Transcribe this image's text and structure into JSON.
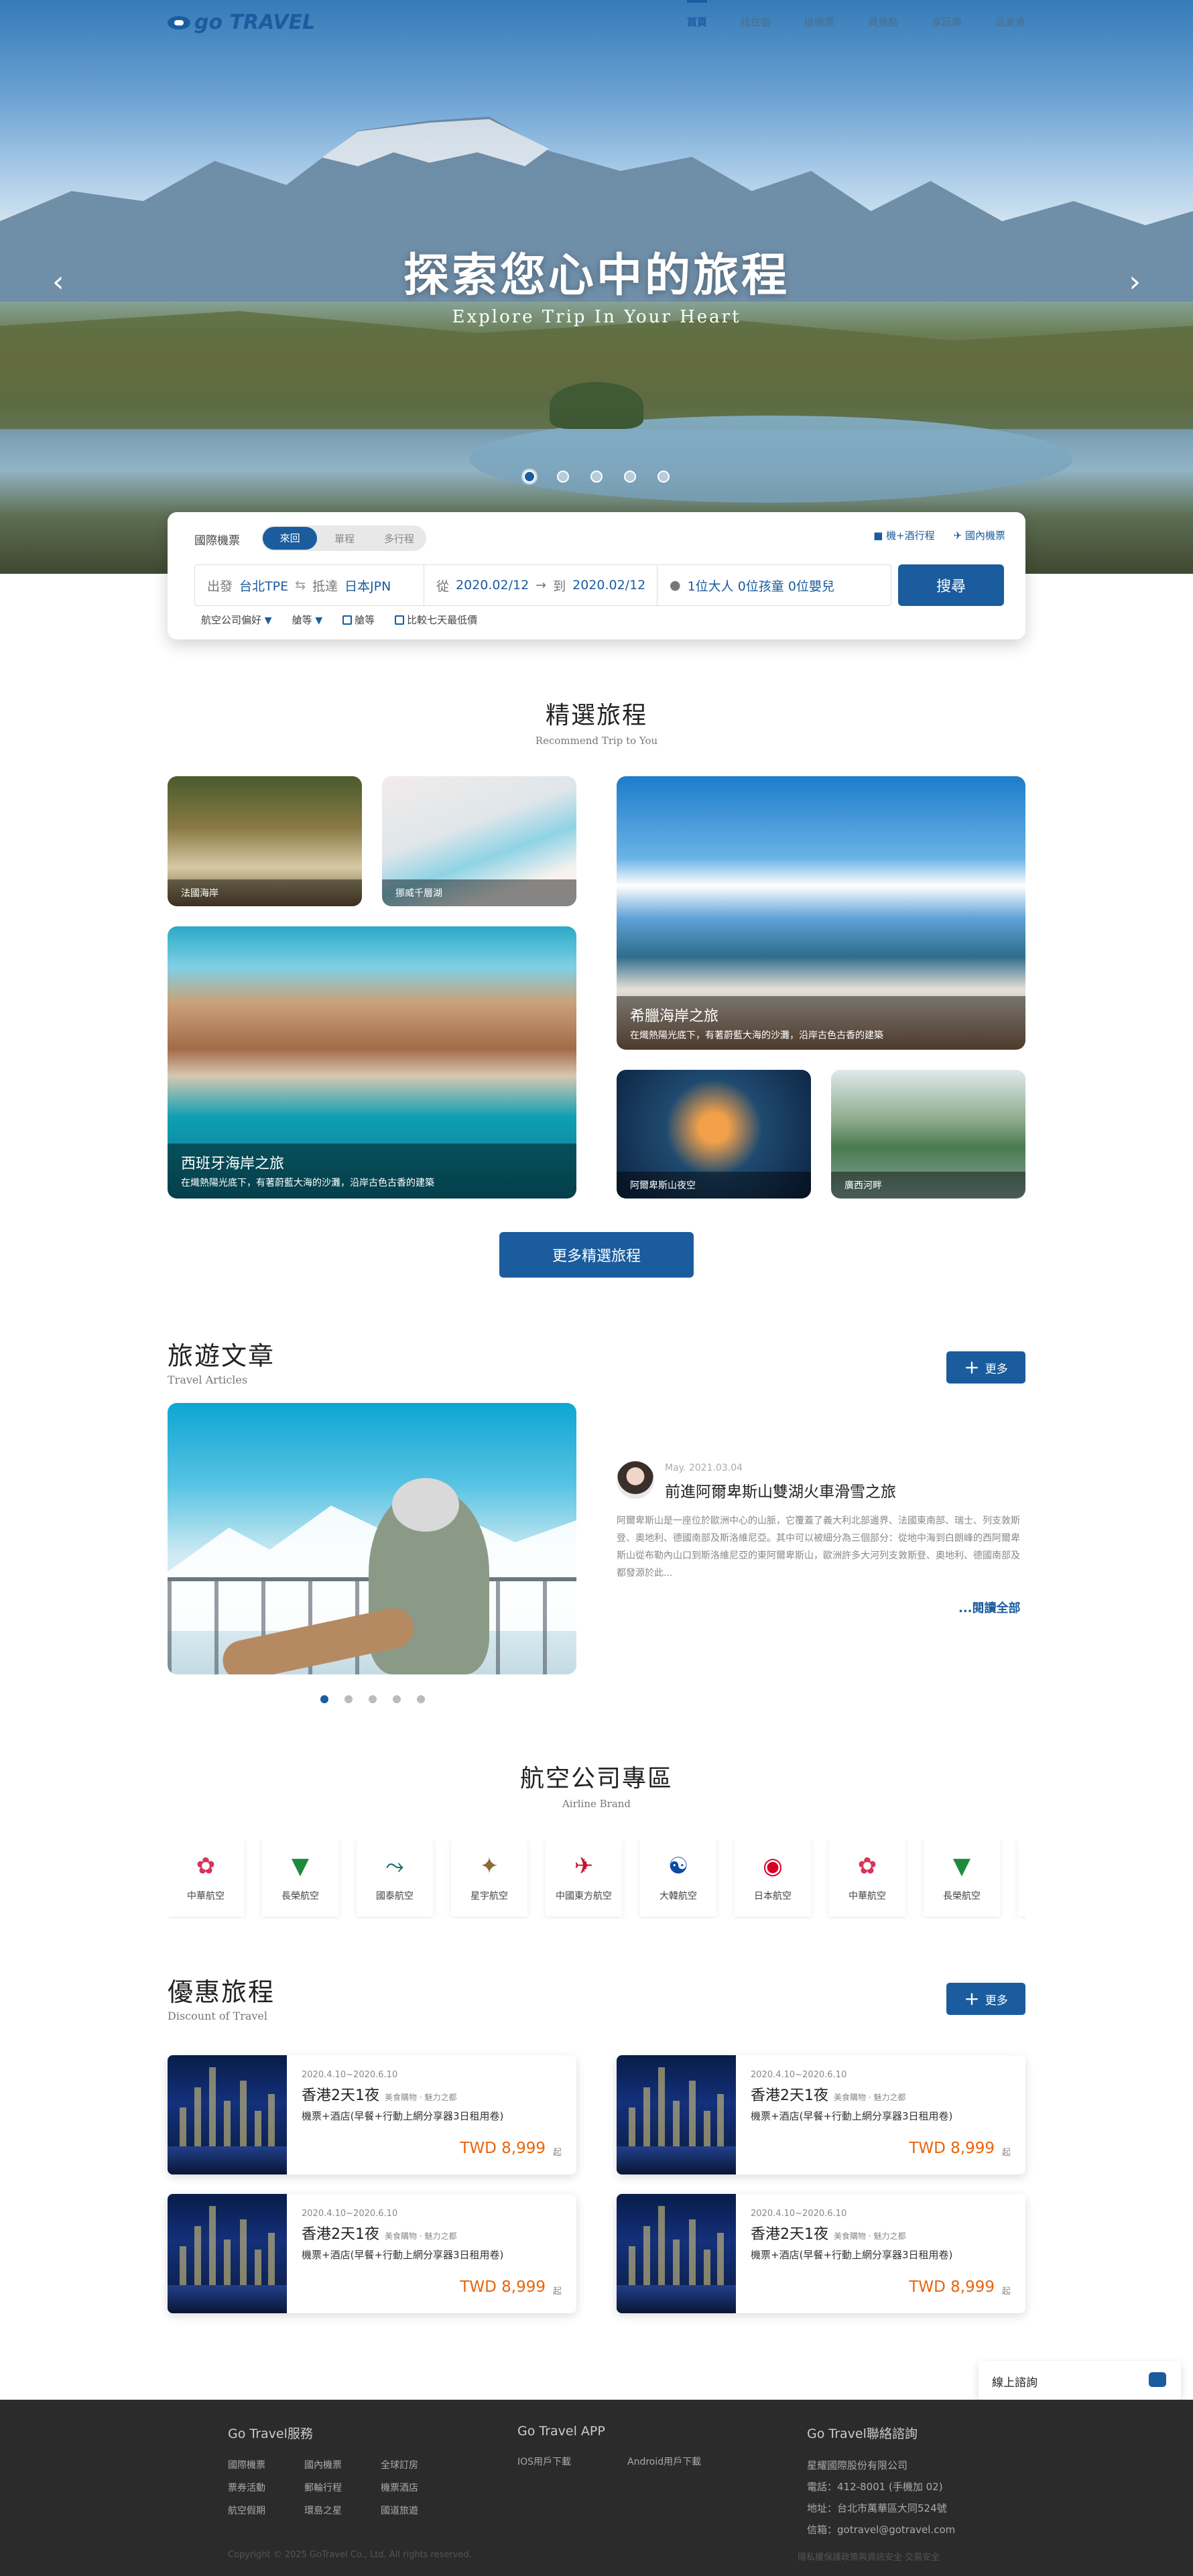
{
  "brand": {
    "logo": "go TRAVEL"
  },
  "nav": {
    "items": [
      "首頁",
      "找住宿",
      "搶機票",
      "買景點",
      "享玩樂",
      "品美食"
    ]
  },
  "hero": {
    "title": "探索您心中的旅程",
    "subtitle": "Explore Trip In Your Heart"
  },
  "search": {
    "type_label": "國際機票",
    "segments": [
      "來回",
      "單程",
      "多行程"
    ],
    "link_hotel": "機+酒行程",
    "link_domestic": "國內機票",
    "from_label": "出發",
    "from_value": "台北TPE",
    "to_label": "抵達",
    "to_value": "日本JPN",
    "date_from_label": "從",
    "date_from": "2020.02/12",
    "date_to_label": "到",
    "date_to": "2020.02/12",
    "passengers": "1位大人  0位孩童  0位嬰兒",
    "button": "搜尋",
    "opt_airline": "航空公司偏好",
    "opt_class": "艙等",
    "opt_check1": "艙等",
    "opt_check2": "比較七天最低價"
  },
  "featured": {
    "title": "精選旅程",
    "subtitle": "Recommend Trip to You",
    "cards": [
      {
        "label": "法國海岸"
      },
      {
        "label": "挪威千層湖"
      },
      {
        "title": "希臘海岸之旅",
        "desc": "在熾熱陽光底下，有著蔚藍大海的沙灘，沿岸古色古香的建築"
      },
      {
        "title": "西班牙海岸之旅",
        "desc": "在熾熱陽光底下，有著蔚藍大海的沙灘，沿岸古色古香的建築"
      },
      {
        "label": "阿爾卑斯山夜空"
      },
      {
        "label": "廣西河畔"
      }
    ],
    "more": "更多精選旅程"
  },
  "articles": {
    "title": "旅遊文章",
    "subtitle": "Travel Articles",
    "more": "更多",
    "date": "May. 2021.03.04",
    "headline": "前進阿爾卑斯山雙湖火車滑雪之旅",
    "body": "阿爾卑斯山是一座位於歐洲中心的山脈，它覆蓋了義大利北部邊界、法國東南部、瑞士、列支敦斯登、奧地利、德國南部及斯洛維尼亞。其中可以被細分為三個部分：從地中海到白朗峰的西阿爾卑斯山從布勒內山口到斯洛維尼亞的東阿爾卑斯山，歐洲許多大河列支敦斯登、奧地利、德國南部及都發源於此...",
    "read_all": "...閱讀全部"
  },
  "airlines": {
    "title": "航空公司專區",
    "subtitle": "Airline Brand",
    "items": [
      {
        "name": "中華航空",
        "icon": "plum-blossom-icon",
        "color": "#d8335a",
        "glyph": "✿"
      },
      {
        "name": "長榮航空",
        "icon": "evergreen-icon",
        "color": "#1f8a3c",
        "glyph": "▼"
      },
      {
        "name": "國泰航空",
        "icon": "cathay-wing-icon",
        "color": "#0b6b6b",
        "glyph": "⤳"
      },
      {
        "name": "星宇航空",
        "icon": "starlux-icon",
        "color": "#8c6a3a",
        "glyph": "✦"
      },
      {
        "name": "中國東方航空",
        "icon": "china-eastern-icon",
        "color": "#c8102e",
        "glyph": "✈"
      },
      {
        "name": "大韓航空",
        "icon": "taeguk-icon",
        "color": "#0a4aa0",
        "glyph": "☯"
      },
      {
        "name": "日本航空",
        "icon": "crane-icon",
        "color": "#d7002a",
        "glyph": "◉"
      },
      {
        "name": "中華航空",
        "icon": "plum-blossom-icon",
        "color": "#d8335a",
        "glyph": "✿"
      },
      {
        "name": "長榮航空",
        "icon": "evergreen-icon",
        "color": "#1f8a3c",
        "glyph": "▼"
      }
    ]
  },
  "deals": {
    "title": "優惠旅程",
    "subtitle": "Discount of Travel",
    "more": "更多",
    "items": [
      {
        "date": "2020.4.10~2020.6.10",
        "name": "香港2天1夜",
        "tags": "美食購物 · 魅力之都",
        "desc": "機票+酒店(早餐+行動上網分享器3日租用卷)",
        "price": "TWD 8,999",
        "unit": "起"
      },
      {
        "date": "2020.4.10~2020.6.10",
        "name": "香港2天1夜",
        "tags": "美食購物 · 魅力之都",
        "desc": "機票+酒店(早餐+行動上網分享器3日租用卷)",
        "price": "TWD 8,999",
        "unit": "起"
      },
      {
        "date": "2020.4.10~2020.6.10",
        "name": "香港2天1夜",
        "tags": "美食購物 · 魅力之都",
        "desc": "機票+酒店(早餐+行動上網分享器3日租用卷)",
        "price": "TWD 8,999",
        "unit": "起"
      },
      {
        "date": "2020.4.10~2020.6.10",
        "name": "香港2天1夜",
        "tags": "美食購物 · 魅力之都",
        "desc": "機票+酒店(早餐+行動上網分享器3日租用卷)",
        "price": "TWD 8,999",
        "unit": "起"
      }
    ]
  },
  "chat": {
    "label": "線上諮詢"
  },
  "footer": {
    "service_title": "Go Travel服務",
    "service_links": [
      "國際機票",
      "國內機票",
      "全球訂房",
      "票券活動",
      "郵輪行程",
      "機票酒店",
      "航空假期",
      "環島之星",
      "國道旅遊"
    ],
    "app_title": "Go Travel APP",
    "app_links": [
      "IOS用戶下載",
      "Android用戶下載"
    ],
    "contact_title": "Go Travel聯絡諮詢",
    "contact_lines": [
      "星耀國際股份有限公司",
      "電話：412-8001 (手機加 02)",
      "地址：台北市萬華區大同524號",
      "信箱：gotravel@gotravel.com"
    ],
    "copyright": "Copyright © 2025 GoTravel Co., Ltd. All rights reserved.",
    "policy": "隱私權保護政策與資訊安全    交易安全"
  },
  "colors": {
    "primary": "#1a5c9e",
    "price": "#e8650d",
    "footer_bg": "#2b2b2b"
  }
}
